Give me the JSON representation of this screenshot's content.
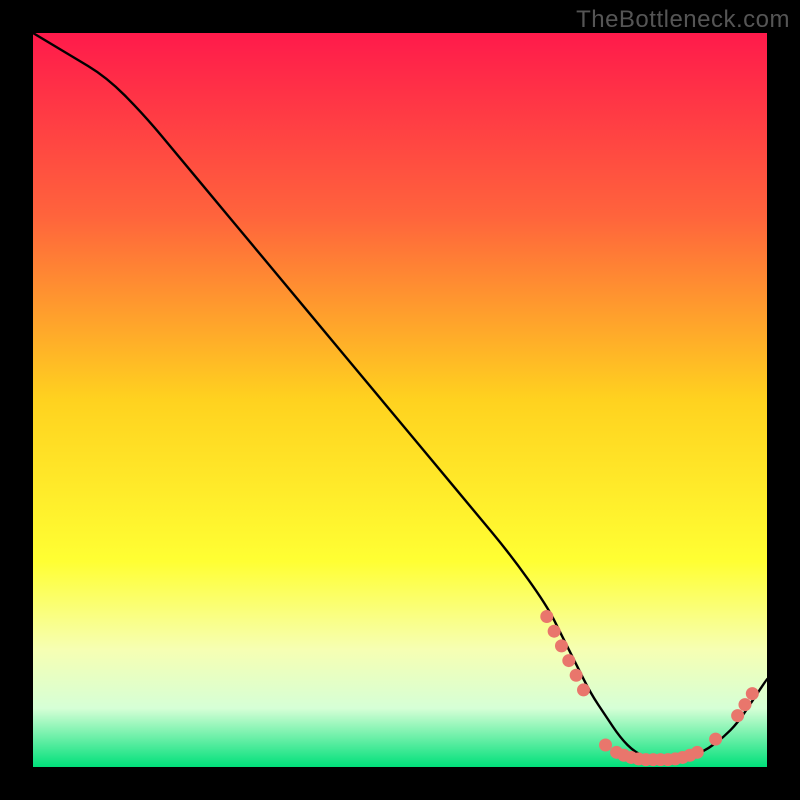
{
  "watermark": "TheBottleneck.com",
  "chart_data": {
    "type": "line",
    "title": "",
    "xlabel": "",
    "ylabel": "",
    "xlim": [
      0,
      100
    ],
    "ylim": [
      0,
      100
    ],
    "grid": false,
    "legend": false,
    "background_gradient": {
      "stops": [
        {
          "offset": 0.0,
          "color": "#ff1a4b"
        },
        {
          "offset": 0.25,
          "color": "#ff643c"
        },
        {
          "offset": 0.5,
          "color": "#ffd21f"
        },
        {
          "offset": 0.72,
          "color": "#ffff33"
        },
        {
          "offset": 0.84,
          "color": "#f6ffb3"
        },
        {
          "offset": 0.92,
          "color": "#d6ffd6"
        },
        {
          "offset": 1.0,
          "color": "#00e07a"
        }
      ]
    },
    "series": [
      {
        "name": "bottleneck-curve",
        "color": "#000000",
        "x": [
          0,
          5,
          10,
          15,
          20,
          25,
          30,
          35,
          40,
          45,
          50,
          55,
          60,
          65,
          70,
          72,
          74,
          76,
          78,
          80,
          82,
          84,
          86,
          88,
          90,
          92,
          94,
          96,
          98,
          100
        ],
        "y": [
          100,
          97,
          94,
          89,
          83,
          77,
          71,
          65,
          59,
          53,
          47,
          41,
          35,
          29,
          22,
          18,
          14,
          10,
          7,
          4,
          2,
          1.2,
          1,
          1,
          1.5,
          2.5,
          4,
          6,
          9,
          12
        ]
      }
    ],
    "markers": {
      "comment": "Salmon dots along the valley and right-hand rise",
      "color": "#e9766c",
      "radius": 6.5,
      "points": [
        {
          "x": 70.0,
          "y": 20.5
        },
        {
          "x": 71.0,
          "y": 18.5
        },
        {
          "x": 72.0,
          "y": 16.5
        },
        {
          "x": 73.0,
          "y": 14.5
        },
        {
          "x": 74.0,
          "y": 12.5
        },
        {
          "x": 75.0,
          "y": 10.5
        },
        {
          "x": 78.0,
          "y": 3.0
        },
        {
          "x": 79.5,
          "y": 2.0
        },
        {
          "x": 80.5,
          "y": 1.6
        },
        {
          "x": 81.5,
          "y": 1.3
        },
        {
          "x": 82.5,
          "y": 1.1
        },
        {
          "x": 83.5,
          "y": 1.0
        },
        {
          "x": 84.5,
          "y": 1.0
        },
        {
          "x": 85.5,
          "y": 1.0
        },
        {
          "x": 86.5,
          "y": 1.0
        },
        {
          "x": 87.5,
          "y": 1.1
        },
        {
          "x": 88.5,
          "y": 1.3
        },
        {
          "x": 89.5,
          "y": 1.6
        },
        {
          "x": 90.5,
          "y": 2.0
        },
        {
          "x": 93.0,
          "y": 3.8
        },
        {
          "x": 96.0,
          "y": 7.0
        },
        {
          "x": 97.0,
          "y": 8.5
        },
        {
          "x": 98.0,
          "y": 10.0
        }
      ]
    }
  }
}
